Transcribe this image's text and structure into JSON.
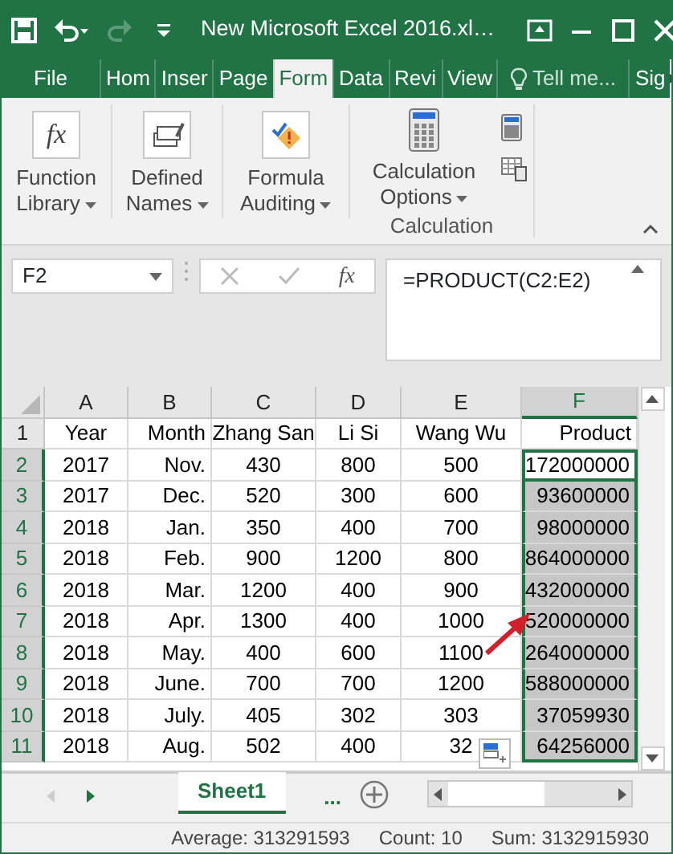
{
  "window": {
    "title": "New Microsoft Excel 2016.xl…"
  },
  "tabs": [
    {
      "label": "File",
      "selected": false,
      "kind": "tab"
    },
    {
      "label": "Hom",
      "selected": false,
      "kind": "tab"
    },
    {
      "label": "Inser",
      "selected": false,
      "kind": "tab"
    },
    {
      "label": "Page",
      "selected": false,
      "kind": "tab"
    },
    {
      "label": "Form",
      "selected": true,
      "kind": "tab"
    },
    {
      "label": "Data",
      "selected": false,
      "kind": "tab"
    },
    {
      "label": "Revi",
      "selected": false,
      "kind": "tab"
    },
    {
      "label": "View",
      "selected": false,
      "kind": "tab"
    },
    {
      "label": "Tell me...",
      "selected": false,
      "kind": "search"
    },
    {
      "label": "Sig",
      "selected": false,
      "kind": "tab"
    }
  ],
  "ribbon": {
    "buttons": [
      {
        "label": "Function Library",
        "kind": "fx",
        "icon_text": "fx"
      },
      {
        "label": "Defined Names",
        "kind": "names"
      },
      {
        "label": "Formula Auditing",
        "kind": "audit"
      },
      {
        "label": "Calculation Options",
        "kind": "calc"
      }
    ],
    "group_label": "Calculation"
  },
  "name_box": {
    "value": "F2"
  },
  "formula": {
    "value": "=PRODUCT(C2:E2)",
    "insert_function": "fx"
  },
  "columns": [
    {
      "label": "A",
      "selected": false
    },
    {
      "label": "B",
      "selected": false
    },
    {
      "label": "C",
      "selected": false
    },
    {
      "label": "D",
      "selected": false
    },
    {
      "label": "E",
      "selected": false
    },
    {
      "label": "F",
      "selected": true
    }
  ],
  "rows": [
    {
      "number": "1",
      "selected": false,
      "active": false,
      "cells": [
        "Year",
        "Month",
        "Zhang San",
        "Li Si",
        "Wang Wu",
        "Product"
      ]
    },
    {
      "number": "2",
      "selected": true,
      "active": true,
      "cells": [
        "2017",
        "Nov.",
        "430",
        "800",
        "500",
        "172000000"
      ]
    },
    {
      "number": "3",
      "selected": true,
      "active": false,
      "cells": [
        "2017",
        "Dec.",
        "520",
        "300",
        "600",
        "93600000"
      ]
    },
    {
      "number": "4",
      "selected": true,
      "active": false,
      "cells": [
        "2018",
        "Jan.",
        "350",
        "400",
        "700",
        "98000000"
      ]
    },
    {
      "number": "5",
      "selected": true,
      "active": false,
      "cells": [
        "2018",
        "Feb.",
        "900",
        "1200",
        "800",
        "864000000"
      ]
    },
    {
      "number": "6",
      "selected": true,
      "active": false,
      "cells": [
        "2018",
        "Mar.",
        "1200",
        "400",
        "900",
        "432000000"
      ]
    },
    {
      "number": "7",
      "selected": true,
      "active": false,
      "cells": [
        "2018",
        "Apr.",
        "1300",
        "400",
        "1000",
        "520000000"
      ]
    },
    {
      "number": "8",
      "selected": true,
      "active": false,
      "cells": [
        "2018",
        "May.",
        "400",
        "600",
        "1100",
        "264000000"
      ]
    },
    {
      "number": "9",
      "selected": true,
      "active": false,
      "cells": [
        "2018",
        "June.",
        "700",
        "700",
        "1200",
        "588000000"
      ]
    },
    {
      "number": "10",
      "selected": true,
      "active": false,
      "cells": [
        "2018",
        "July.",
        "405",
        "302",
        "303",
        "37059930"
      ]
    },
    {
      "number": "11",
      "selected": true,
      "active": false,
      "cells": [
        "2018",
        "Aug.",
        "502",
        "400",
        "32",
        "64256000"
      ]
    }
  ],
  "sheet_tabs": [
    {
      "label": "Sheet1",
      "selected": true
    }
  ],
  "more_sheets": "...",
  "status_bar": [
    "Average: 313291593",
    "Count: 10",
    "Sum: 3132915930"
  ]
}
